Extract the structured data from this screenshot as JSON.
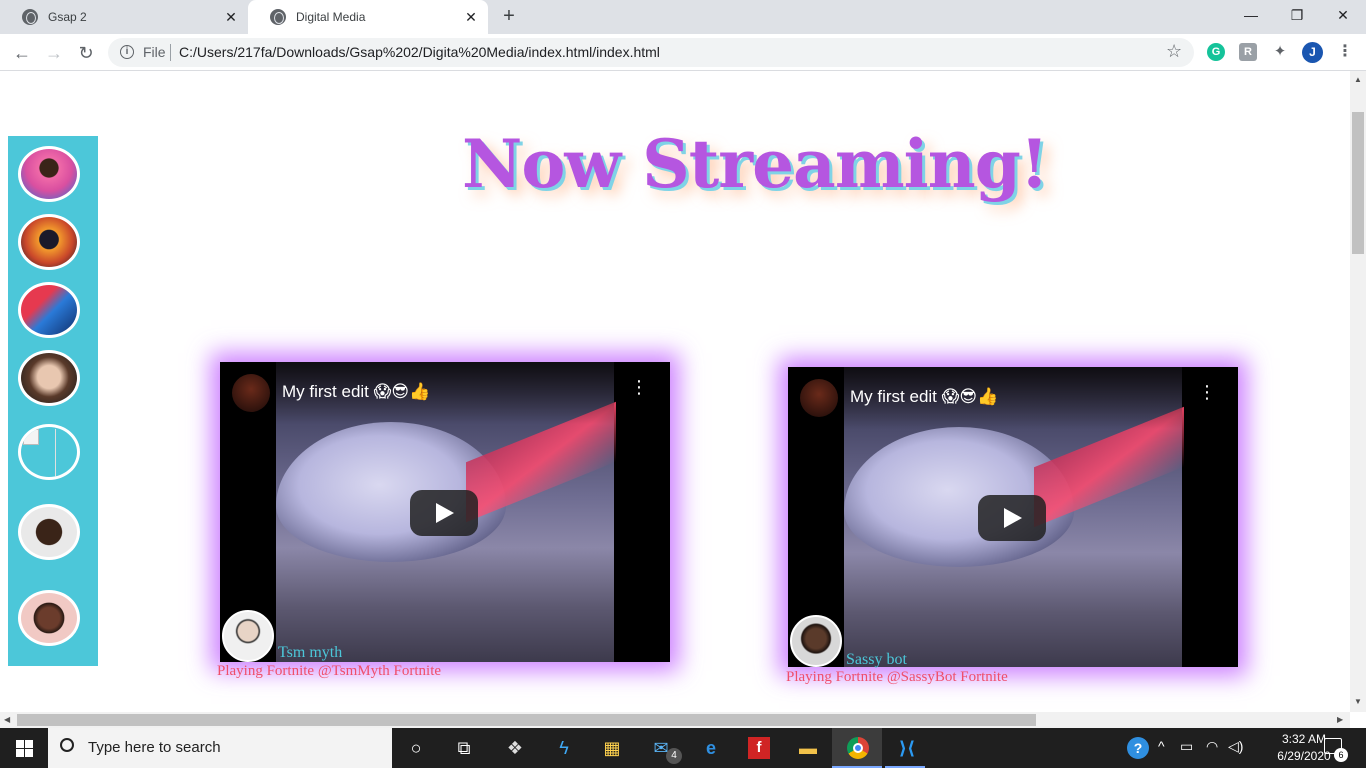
{
  "browser": {
    "tabs": [
      {
        "title": "Gsap 2",
        "active": false
      },
      {
        "title": "Digital Media",
        "active": true
      }
    ],
    "new_tab": "+",
    "window_controls": {
      "minimize": "—",
      "maximize": "❐",
      "close": "✕"
    },
    "nav": {
      "back": "←",
      "forward": "→",
      "reload": "↻"
    },
    "address": {
      "scheme_label": "File",
      "url": "C:/Users/217fa/Downloads/Gsap%202/Digita%20Media/index.html/index.html"
    },
    "profile_initial": "J"
  },
  "page": {
    "headline": "Now Streaming!",
    "sidebar": {
      "avatars": [
        {
          "name": "avatar-1",
          "colors": [
            "#f06aa8",
            "#2d6cd6"
          ]
        },
        {
          "name": "avatar-2",
          "colors": [
            "#f39a2c",
            "#1a1a2a"
          ]
        },
        {
          "name": "avatar-3",
          "colors": [
            "#2a7ad8",
            "#e6394f"
          ]
        },
        {
          "name": "avatar-4",
          "colors": [
            "#e8c7b0",
            "#5a3a2a"
          ]
        },
        {
          "name": "avatar-5-broken",
          "colors": [
            "#4cc7d9",
            "#4cc7d9"
          ]
        },
        {
          "name": "avatar-6",
          "colors": [
            "#e9e9e9",
            "#3a2418"
          ]
        },
        {
          "name": "avatar-7",
          "colors": [
            "#f1c9c4",
            "#2a1a14"
          ]
        }
      ]
    },
    "streams": [
      {
        "video_title": "My first edit 😱😎👍",
        "menu_icon": "⋮",
        "streamer_name": "Tsm myth",
        "caption": "Playing Fortnite @TsmMyth Fortnite"
      },
      {
        "video_title": "My first edit 😱😎👍",
        "menu_icon": "⋮",
        "streamer_name": "Sassy bot",
        "caption": "Playing Fortnite @SassyBot Fortnite"
      }
    ]
  },
  "taskbar": {
    "search_placeholder": "Type here to search",
    "mail_badge": "4",
    "clock": {
      "time": "3:32 AM",
      "date": "6/29/2020"
    },
    "notification_count": "6"
  }
}
